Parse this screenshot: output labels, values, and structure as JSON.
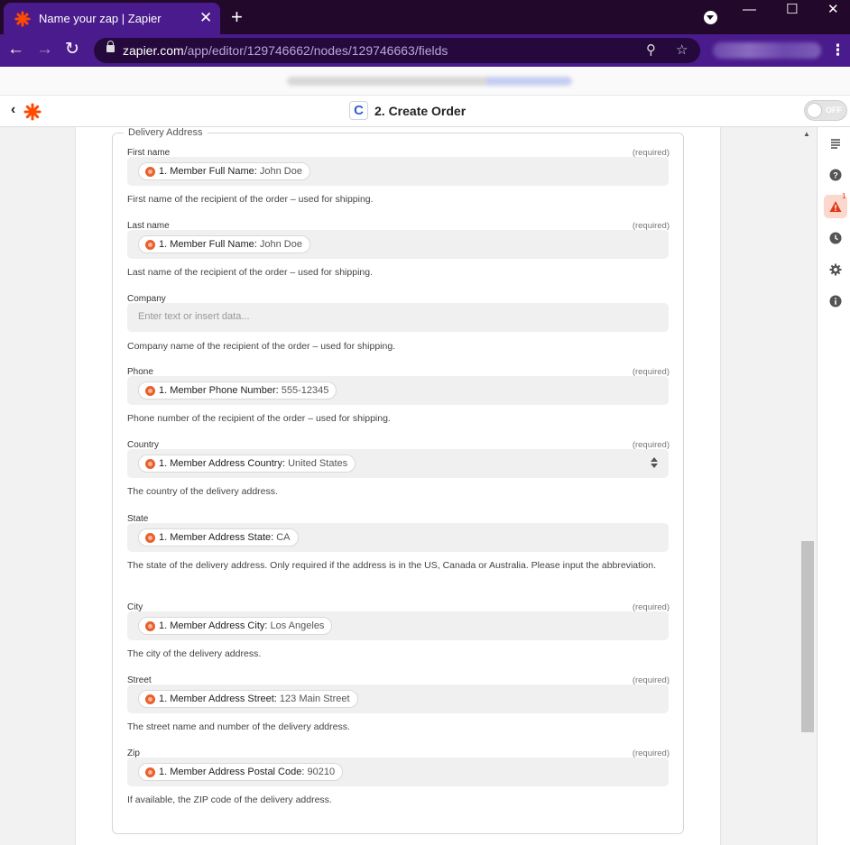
{
  "browser": {
    "tab_title": "Name your zap | Zapier",
    "tab_close": "✕",
    "new_tab": "+",
    "url_host": "zapier.com",
    "url_path": "/app/editor/129746662/nodes/129746663/fields",
    "win_min": "—",
    "win_max": "☐",
    "win_close": "✕",
    "menu": "⋮"
  },
  "header": {
    "back": "‹",
    "step_icon_letter": "C",
    "step_title": "2. Create Order",
    "toggle_label": "OFF"
  },
  "form": {
    "legend": "Delivery Address",
    "required_label": "(required)",
    "fields": [
      {
        "label": "First name",
        "required": true,
        "pill_name": "1. Member Full Name:",
        "pill_value": "John Doe",
        "help": "First name of the recipient of the order – used for shipping."
      },
      {
        "label": "Last name",
        "required": true,
        "pill_name": "1. Member Full Name:",
        "pill_value": "John Doe",
        "help": "Last name of the recipient of the order – used for shipping."
      },
      {
        "label": "Company",
        "required": false,
        "placeholder": "Enter text or insert data...",
        "help": "Company name of the recipient of the order – used for shipping."
      },
      {
        "label": "Phone",
        "required": true,
        "pill_name": "1. Member Phone Number:",
        "pill_value": "555-12345",
        "help": "Phone number of the recipient of the order – used for shipping."
      },
      {
        "label": "Country",
        "required": true,
        "pill_name": "1. Member Address Country:",
        "pill_value": "United States",
        "help": "The country of the delivery address."
      },
      {
        "label": "State",
        "required": false,
        "pill_name": "1. Member Address State:",
        "pill_value": "CA",
        "help": "The state of the delivery address. Only required if the address is in the US, Canada or Australia. Please input the abbreviation."
      },
      {
        "label": "City",
        "required": true,
        "pill_name": "1. Member Address City:",
        "pill_value": "Los Angeles",
        "help": "The city of the delivery address."
      },
      {
        "label": "Street",
        "required": true,
        "pill_name": "1. Member Address Street:",
        "pill_value": "123 Main Street",
        "help": "The street name and number of the delivery address."
      },
      {
        "label": "Zip",
        "required": true,
        "pill_name": "1. Member Address Postal Code:",
        "pill_value": "90210",
        "help": "If available, the ZIP code of the delivery address."
      }
    ]
  },
  "rail": {
    "alert_count": "1",
    "icons": [
      "outline-icon",
      "help-icon",
      "alert-icon",
      "history-icon",
      "settings-icon",
      "info-icon"
    ]
  },
  "colors": {
    "chrome": "#22082b",
    "toolbar": "#4a1b8c",
    "zapier_orange": "#ff4a00",
    "alert_bg": "#fbd7cd"
  }
}
